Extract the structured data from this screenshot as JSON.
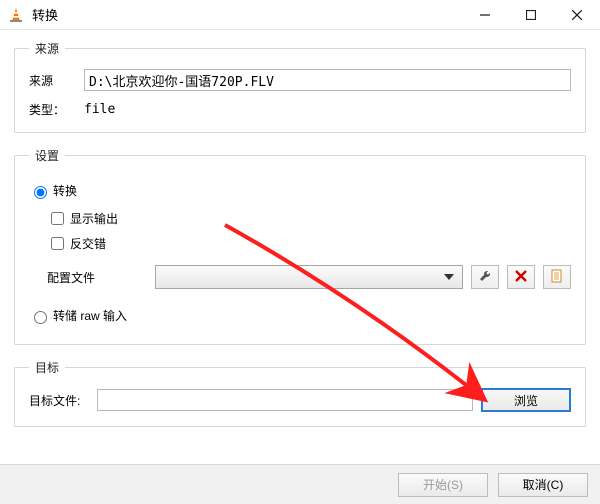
{
  "window": {
    "title": "转换",
    "minimize_tip": "Minimize",
    "maximize_tip": "Maximize",
    "close_tip": "Close"
  },
  "source": {
    "legend": "来源",
    "source_label": "来源",
    "source_value": "D:\\北京欢迎你-国语720P.FLV",
    "type_label": "类型：",
    "type_value": "file"
  },
  "settings": {
    "legend": "设置",
    "radio_convert": "转换",
    "chk_display": "显示输出",
    "chk_deinterlace": "反交错",
    "profile_label": "配置文件",
    "radio_dump": "转储 raw 输入",
    "tools_tip": "Edit",
    "delete_tip": "Delete",
    "new_tip": "New"
  },
  "dest": {
    "legend": "目标",
    "file_label": "目标文件:",
    "file_value": "",
    "browse_label": "浏览"
  },
  "buttons": {
    "start": "开始(S)",
    "cancel": "取消(C)"
  }
}
